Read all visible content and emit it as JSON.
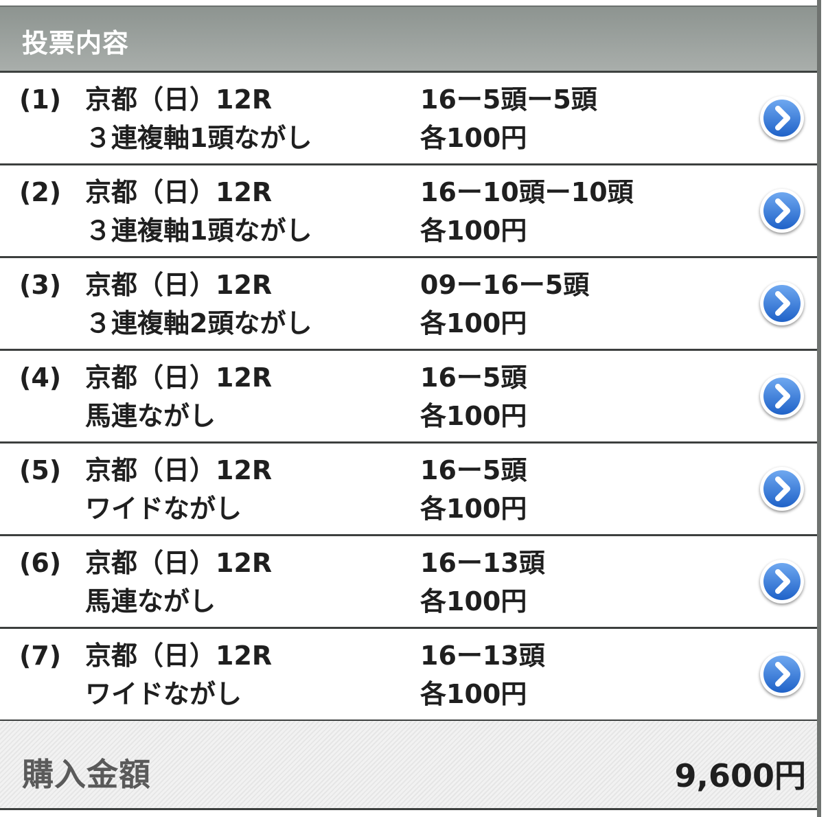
{
  "header": {
    "title": "投票内容"
  },
  "bets": [
    {
      "index": "(1)",
      "race": "京都（日）12R",
      "bet_type": "３連複軸1頭ながし",
      "combination": "16ー5頭ー5頭",
      "amount": "各100円"
    },
    {
      "index": "(2)",
      "race": "京都（日）12R",
      "bet_type": "３連複軸1頭ながし",
      "combination": "16ー10頭ー10頭",
      "amount": "各100円"
    },
    {
      "index": "(3)",
      "race": "京都（日）12R",
      "bet_type": "３連複軸2頭ながし",
      "combination": "09ー16ー5頭",
      "amount": "各100円"
    },
    {
      "index": "(4)",
      "race": "京都（日）12R",
      "bet_type": "馬連ながし",
      "combination": "16ー5頭",
      "amount": "各100円"
    },
    {
      "index": "(5)",
      "race": "京都（日）12R",
      "bet_type": "ワイドながし",
      "combination": "16ー5頭",
      "amount": "各100円"
    },
    {
      "index": "(6)",
      "race": "京都（日）12R",
      "bet_type": "馬連ながし",
      "combination": "16ー13頭",
      "amount": "各100円"
    },
    {
      "index": "(7)",
      "race": "京都（日）12R",
      "bet_type": "ワイドながし",
      "combination": "16ー13頭",
      "amount": "各100円"
    }
  ],
  "footer": {
    "label": "購入金額",
    "total": "9,600円"
  },
  "icons": {
    "row_action": "chevron-right-circle-icon"
  },
  "colors": {
    "header_bg": "#999e9b",
    "chevron_blue": "#2f78d6",
    "divider": "#3c3f3e"
  }
}
